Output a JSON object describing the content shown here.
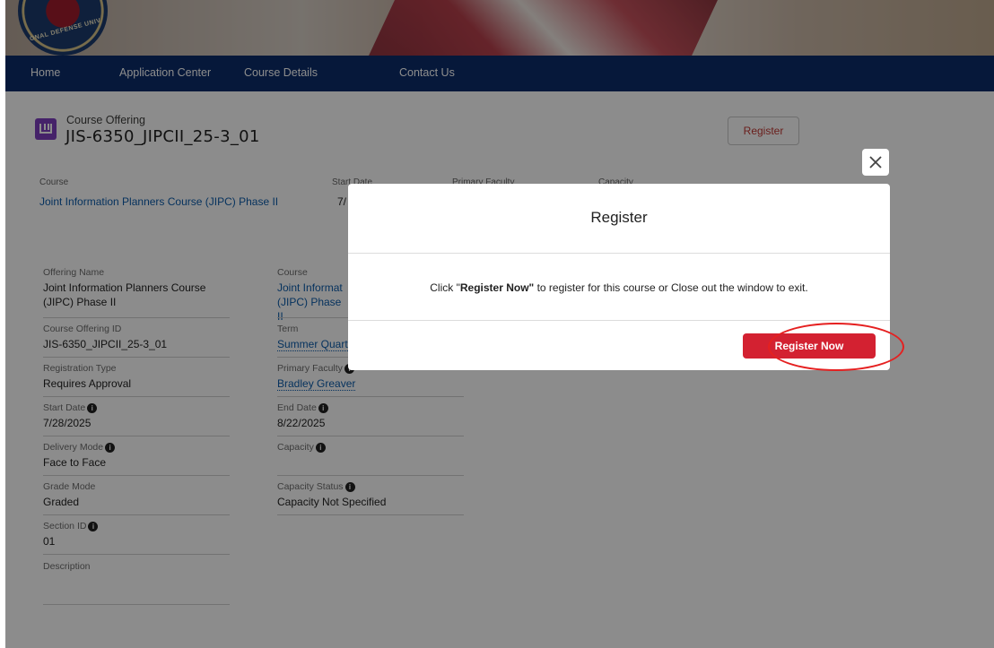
{
  "banner": {
    "seal_text": "ONAL DEFENSE UNIV"
  },
  "nav": {
    "items": [
      "Home",
      "Application Center",
      "Course Details",
      "Contact Us"
    ]
  },
  "header": {
    "object_type": "Course Offering",
    "title": "JIS-6350_JIPCII_25-3_01",
    "register_label": "Register"
  },
  "highlights": {
    "course_label": "Course",
    "course_value": "Joint Information Planners Course (JIPC) Phase II",
    "start_label": "Start Date",
    "start_value": "7/",
    "faculty_label": "Primary Faculty",
    "capacity_label": "Capacity"
  },
  "details_left": [
    {
      "label": "Offering Name",
      "value": "Joint Information Planners Course (JIPC) Phase II"
    },
    {
      "label": "Course Offering ID",
      "value": "JIS-6350_JIPCII_25-3_01"
    },
    {
      "label": "Registration Type",
      "value": "Requires Approval"
    },
    {
      "label": "Start Date",
      "value": "7/28/2025"
    },
    {
      "label": "Delivery Mode",
      "value": "Face to Face"
    },
    {
      "label": "Grade Mode",
      "value": "Graded"
    },
    {
      "label": "Section ID",
      "value": "01"
    },
    {
      "label": "Description",
      "value": ""
    }
  ],
  "details_right": [
    {
      "label": "Course",
      "value": "Joint Informat (JIPC) Phase II"
    },
    {
      "label": "Term",
      "value": "Summer Quart"
    },
    {
      "label": "Primary Faculty",
      "value": "Bradley Greaver"
    },
    {
      "label": "End Date",
      "value": "8/22/2025"
    },
    {
      "label": "Capacity",
      "value": ""
    },
    {
      "label": "Capacity Status",
      "value": "Capacity Not Specified"
    }
  ],
  "modal": {
    "title": "Register",
    "message_prefix": "Click \"",
    "message_bold": "Register Now\"",
    "message_suffix": " to register for this course or Close out the window to exit.",
    "register_now_label": "Register Now",
    "close_icon": "close-icon"
  },
  "colors": {
    "nav_bg": "#0b2d6b",
    "accent_red": "#d32131",
    "link_blue": "#0b5cab",
    "object_icon": "#7f3fbf"
  }
}
